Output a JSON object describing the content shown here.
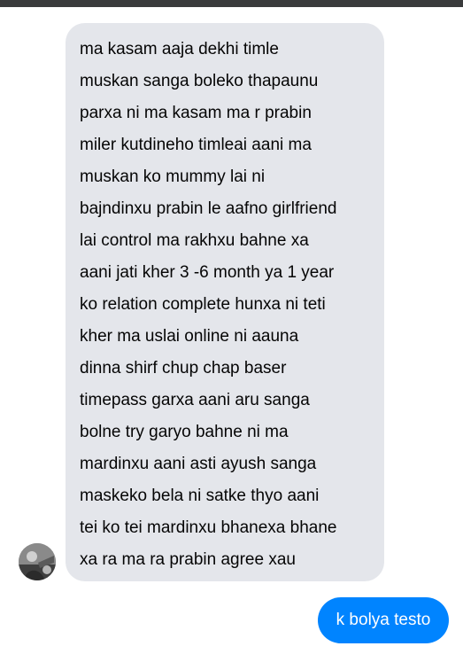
{
  "colors": {
    "topbar": "#3a3b3c",
    "incoming_bubble": "#e4e6eb",
    "incoming_text": "#050505",
    "outgoing_bubble": "#0084ff",
    "outgoing_text": "#ffffff"
  },
  "incoming_message": {
    "lines": [
      "ma kasam aaja dekhi timle",
      "muskan sanga boleko thapaunu",
      "parxa ni ma kasam ma r prabin",
      "miler kutdineho timleai aani ma",
      "muskan ko mummy lai ni",
      "bajndinxu prabin le aafno girlfriend",
      "lai control ma rakhxu bahne xa",
      "aani jati kher 3 -6 month ya 1 year",
      "ko relation complete hunxa ni teti",
      "kher ma uslai online ni aauna",
      "dinna shirf chup chap baser",
      "timepass garxa aani aru sanga",
      "bolne try garyo bahne ni ma",
      "mardinxu aani asti ayush sanga",
      "maskeko bela ni satke thyo aani",
      "tei ko tei mardinxu bhanexa bhane",
      "xa ra ma ra prabin agree xau"
    ],
    "avatar_icon": "user-avatar-photo"
  },
  "outgoing_message": {
    "text": "k bolya testo"
  }
}
